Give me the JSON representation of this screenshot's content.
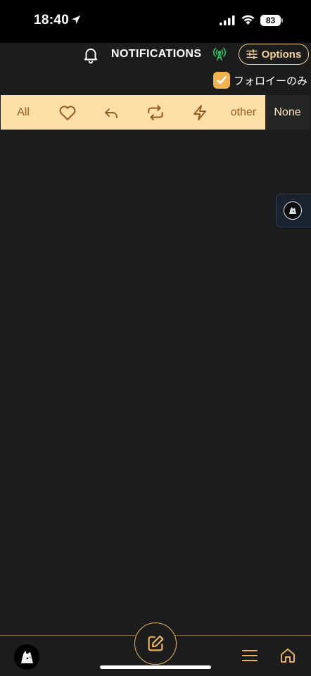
{
  "status_bar": {
    "time": "18:40",
    "battery_level": "83"
  },
  "header": {
    "title": "NOTIFICATIONS",
    "options_label": "Options",
    "accent_color": "#f3d39a",
    "stream_color": "#2fbf62"
  },
  "follow_filter": {
    "label": "フォロイーのみ",
    "checked": true,
    "check_color": "#f2b24e"
  },
  "filter_tabs": {
    "all": "All",
    "other": "other",
    "none": "None",
    "icons": [
      "heart-icon",
      "reply-icon",
      "repost-icon",
      "zap-icon"
    ],
    "background": "#fde0a8",
    "selected": "None"
  },
  "bottom_nav": {
    "icons": [
      "avatar",
      "compose-icon",
      "menu-icon",
      "home-icon"
    ],
    "accent_color": "#e9b35e"
  }
}
